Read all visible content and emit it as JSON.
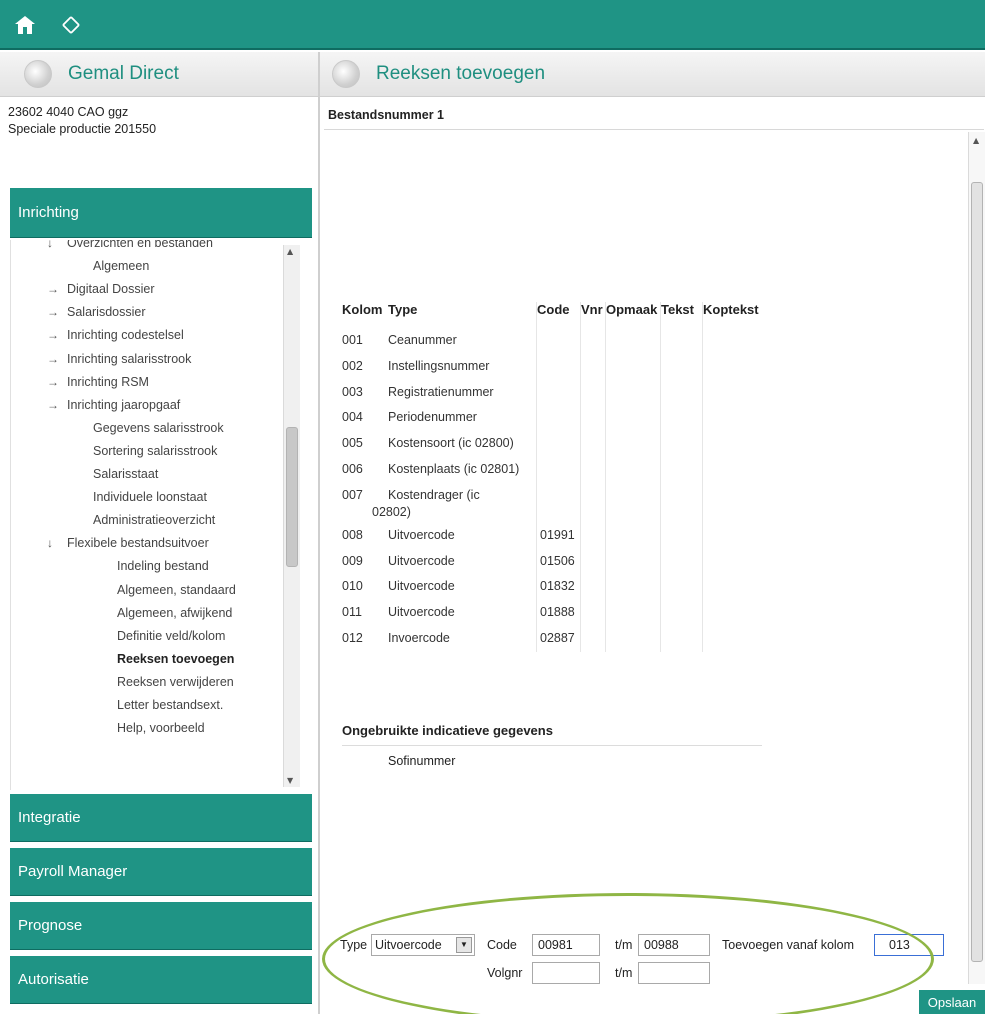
{
  "topbar": {
    "home_icon": "home-icon",
    "sync_icon": "sync-icon"
  },
  "left_header": {
    "title": "Gemal Direct"
  },
  "main_header": {
    "title": "Reeksen toevoegen"
  },
  "left_info": {
    "line1": "23602 4040 CAO ggz",
    "line2": "Speciale productie  201550"
  },
  "sections": {
    "inrichting": "Inrichting",
    "integratie": "Integratie",
    "payroll": "Payroll Manager",
    "prognose": "Prognose",
    "autorisatie": "Autorisatie"
  },
  "tree": [
    {
      "label": "Overzichten en bestanden",
      "arrow": "down",
      "level": 0
    },
    {
      "label": "Algemeen",
      "arrow": "",
      "level": 1
    },
    {
      "label": "Digitaal Dossier",
      "arrow": "right",
      "level": 0
    },
    {
      "label": "Salarisdossier",
      "arrow": "right",
      "level": 0
    },
    {
      "label": "Inrichting codestelsel",
      "arrow": "right",
      "level": 0
    },
    {
      "label": "Inrichting salarisstrook",
      "arrow": "right",
      "level": 0
    },
    {
      "label": "Inrichting RSM",
      "arrow": "right",
      "level": 0
    },
    {
      "label": "Inrichting jaaropgaaf",
      "arrow": "right",
      "level": 0
    },
    {
      "label": "Gegevens salarisstrook",
      "arrow": "",
      "level": 1
    },
    {
      "label": "Sortering salarisstrook",
      "arrow": "",
      "level": 1
    },
    {
      "label": "Salarisstaat",
      "arrow": "",
      "level": 1
    },
    {
      "label": "Individuele loonstaat",
      "arrow": "",
      "level": 1
    },
    {
      "label": "Administratieoverzicht",
      "arrow": "",
      "level": 1
    },
    {
      "label": "Flexibele bestandsuitvoer",
      "arrow": "down",
      "level": 0
    },
    {
      "label": "Indeling bestand",
      "arrow": "",
      "level": 2
    },
    {
      "label": "Algemeen, standaard",
      "arrow": "",
      "level": 2
    },
    {
      "label": "Algemeen, afwijkend",
      "arrow": "",
      "level": 2
    },
    {
      "label": "Definitie veld/kolom",
      "arrow": "",
      "level": 2
    },
    {
      "label": "Reeksen toevoegen",
      "arrow": "",
      "level": 2,
      "selected": true
    },
    {
      "label": "Reeksen verwijderen",
      "arrow": "",
      "level": 2
    },
    {
      "label": "Letter bestandsext.",
      "arrow": "",
      "level": 2
    },
    {
      "label": "Help, voorbeeld",
      "arrow": "",
      "level": 2
    }
  ],
  "main": {
    "file_label": "Bestandsnummer 1",
    "columns": [
      "Kolom",
      "Type",
      "Code",
      "Vnr",
      "Opmaak",
      "Tekst",
      "Koptekst"
    ],
    "rows": [
      {
        "kolom": "001",
        "type": "Ceanummer",
        "code": ""
      },
      {
        "kolom": "002",
        "type": "Instellingsnummer",
        "code": ""
      },
      {
        "kolom": "003",
        "type": "Registratienummer",
        "code": ""
      },
      {
        "kolom": "004",
        "type": "Periodenummer",
        "code": ""
      },
      {
        "kolom": "005",
        "type": "Kostensoort (ic 02800)",
        "code": ""
      },
      {
        "kolom": "006",
        "type": "Kostenplaats (ic 02801)",
        "code": ""
      },
      {
        "kolom": "007",
        "type": "Kostendrager (ic",
        "type2": "02802)",
        "code": ""
      },
      {
        "kolom": "008",
        "type": "Uitvoercode",
        "code": "01991"
      },
      {
        "kolom": "009",
        "type": "Uitvoercode",
        "code": "01506"
      },
      {
        "kolom": "010",
        "type": "Uitvoercode",
        "code": "01832"
      },
      {
        "kolom": "011",
        "type": "Uitvoercode",
        "code": "01888"
      },
      {
        "kolom": "012",
        "type": "Invoercode",
        "code": "02887"
      }
    ],
    "unused_title": "Ongebruikte indicatieve gegevens",
    "unused_items": [
      "Sofinummer"
    ]
  },
  "footer": {
    "type_label": "Type",
    "type_value": "Uitvoercode",
    "code_label": "Code",
    "code_from": "00981",
    "tm_label": "t/m",
    "code_to": "00988",
    "from_col_label": "Toevoegen vanaf kolom",
    "from_col_value": "013",
    "volgnr_label": "Volgnr",
    "volgnr_from": "",
    "tm2_label": "t/m",
    "volgnr_to": "",
    "save_label": "Opslaan"
  },
  "colors": {
    "accent": "#1f9485",
    "highlight_ellipse": "#8fb645"
  }
}
